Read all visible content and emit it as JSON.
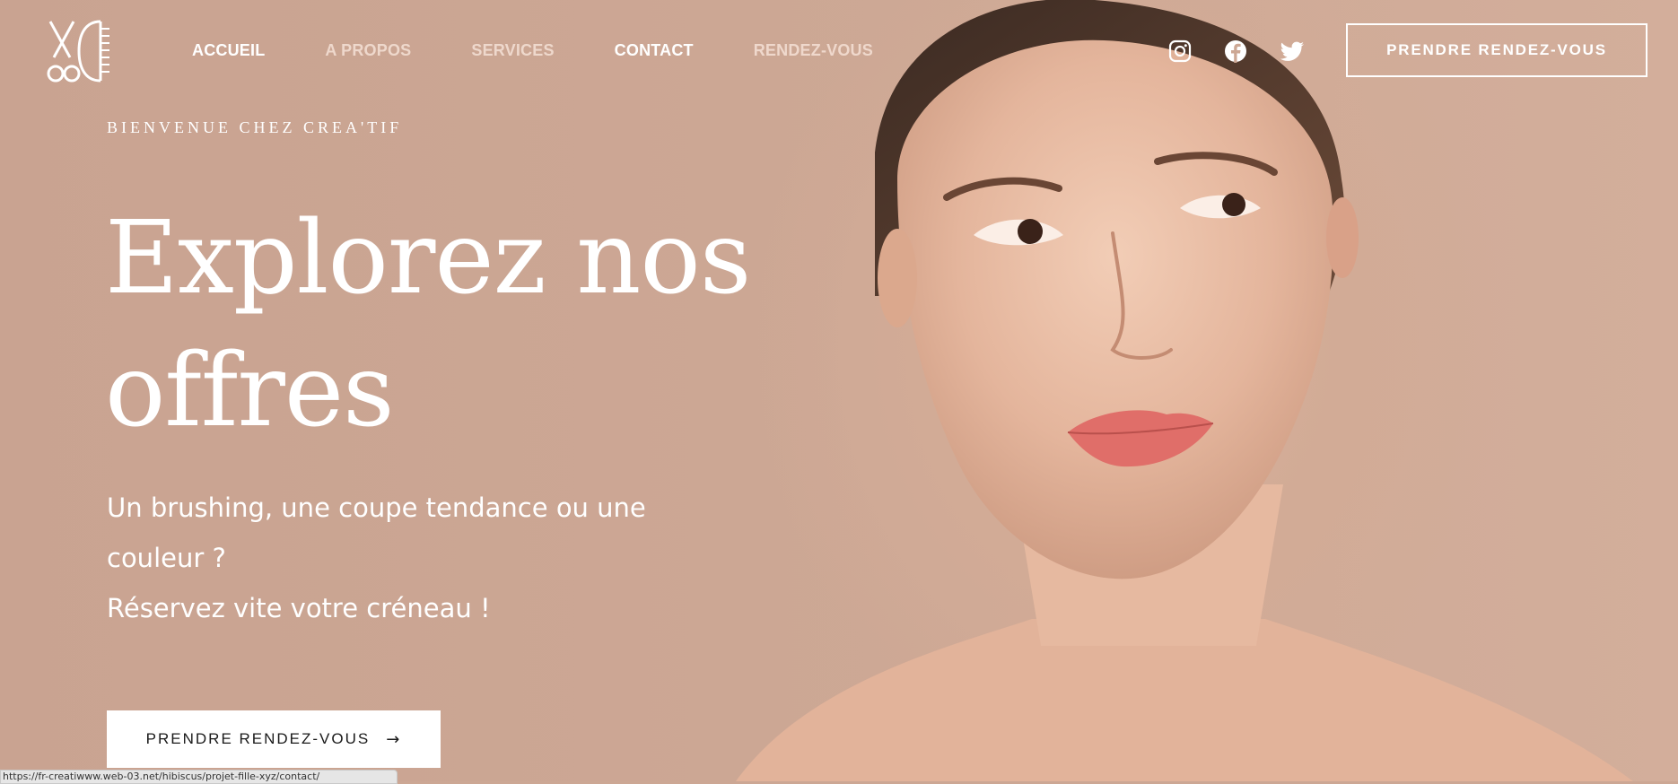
{
  "colors": {
    "background": "#cca794",
    "text": "#ffffff",
    "button_fill": "#ffffff",
    "button_text": "#1a1a1a"
  },
  "nav": {
    "items": [
      {
        "label": "ACCUEIL"
      },
      {
        "label": "A PROPOS"
      },
      {
        "label": "SERVICES"
      },
      {
        "label": "CONTACT"
      },
      {
        "label": "RENDEZ-VOUS"
      }
    ]
  },
  "social": {
    "icons": [
      "instagram-icon",
      "facebook-icon",
      "twitter-icon"
    ]
  },
  "header": {
    "cta_label": "PRENDRE RENDEZ-VOUS"
  },
  "hero": {
    "eyebrow": "BIENVENUE CHEZ CREA'TIF",
    "headline_line1": "Explorez nos",
    "headline_line2": "offres",
    "sub_line1": "Un brushing, une coupe tendance ou une",
    "sub_line2": "couleur ?",
    "sub_line3": "Réservez vite votre créneau !",
    "cta_label": "PRENDRE RENDEZ-VOUS",
    "cta_arrow": "→"
  },
  "status_bar": {
    "url": "https://fr-creatiwww.web-03.net/hibiscus/projet-fille-xyz/contact/"
  }
}
